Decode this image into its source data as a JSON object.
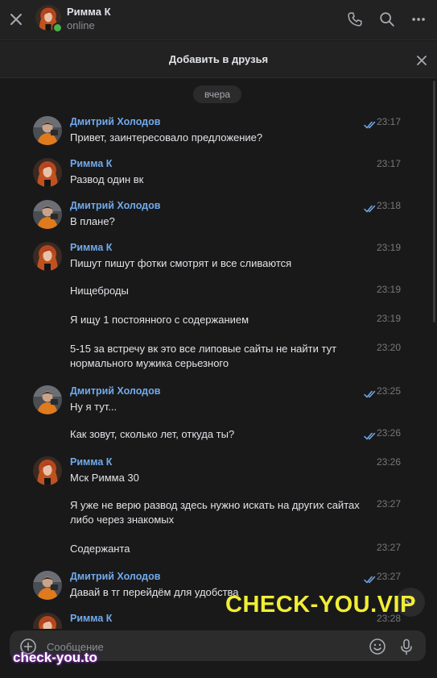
{
  "header": {
    "name": "Римма К",
    "status": "online",
    "icons": [
      "close-icon",
      "phone-icon",
      "search-icon",
      "more-icon"
    ]
  },
  "add_friend_bar": {
    "label": "Добавить в друзья"
  },
  "date_separator": "вчера",
  "messages": [
    {
      "author": "Дмитрий Холодов",
      "text": "Привет, заинтересовало предложение?",
      "time": "23:17",
      "read": true
    },
    {
      "author": "Римма К",
      "text": "Развод один вк",
      "time": "23:17"
    },
    {
      "author": "Дмитрий Холодов",
      "text": "В плане?",
      "time": "23:18",
      "read": true
    },
    {
      "author": "Римма К",
      "text": "Пишут пишут фотки смотрят и все сливаются",
      "time": "23:19"
    },
    {
      "text": "Нищеброды",
      "time": "23:19"
    },
    {
      "text": "Я ищу 1 постоянного с содержанием",
      "time": "23:19"
    },
    {
      "text": "5-15 за встречу вк это все липовые сайты не найти тут нормального мужика серьезного",
      "time": "23:20"
    },
    {
      "author": "Дмитрий Холодов",
      "text": "Ну я тут...",
      "time": "23:25",
      "read": true
    },
    {
      "text": "Как зовут, сколько лет, откуда ты?",
      "time": "23:26",
      "read": true
    },
    {
      "author": "Римма К",
      "text": "Мск Римма 30",
      "time": "23:26"
    },
    {
      "text": "Я уже не верю развод здесь нужно искать на других сайтах либо через знакомых",
      "time": "23:27"
    },
    {
      "text": "Содержанта",
      "time": "23:27"
    },
    {
      "author": "Дмитрий Холодов",
      "text": "Давай в тг перейдём для удобства",
      "time": "23:27",
      "read": true
    },
    {
      "author": "Римма К",
      "text": "",
      "time": "23:28"
    }
  ],
  "composer": {
    "placeholder": "Сообщение"
  },
  "watermarks": {
    "main": "CHECK-YOU.VIP",
    "corner": "check-you.to"
  },
  "colors": {
    "background": "#19191a",
    "panel": "#222223",
    "author": "#71aaeb",
    "online": "#4bb34b",
    "watermark": "#f1ee35"
  }
}
